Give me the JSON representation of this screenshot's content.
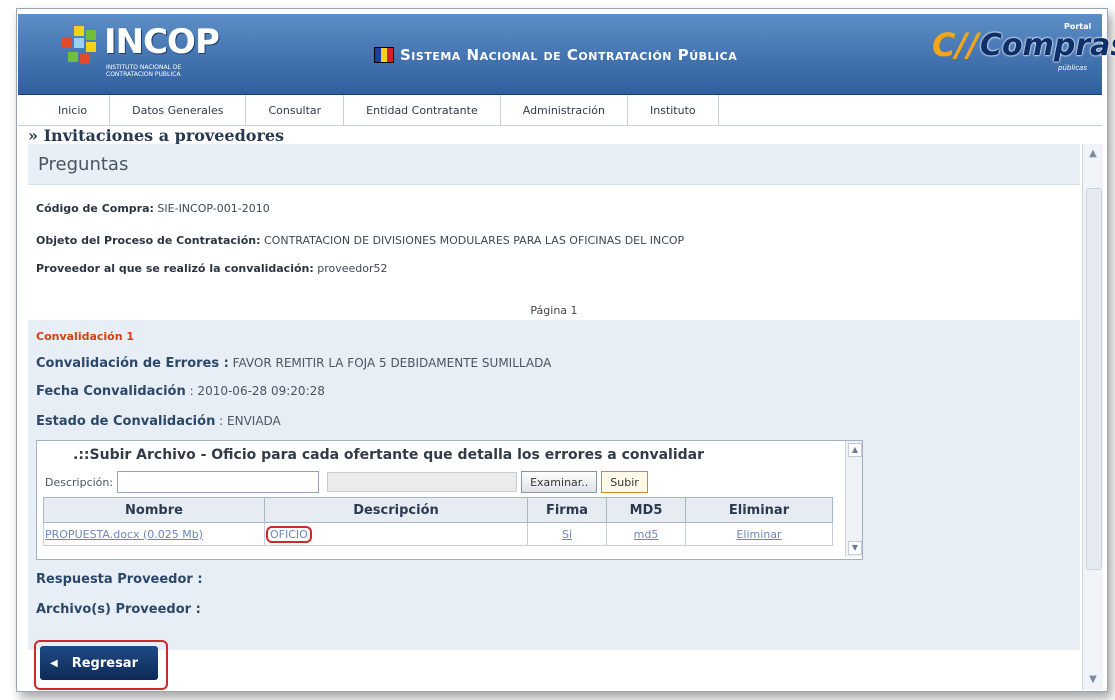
{
  "header": {
    "incop_logo": "INCOP",
    "incop_sub": "INSTITUTO NACIONAL DE CONTRATACION PUBLICA",
    "system_title": "Sistema Nacional de Contratación Pública",
    "compras_logo": "Compras",
    "compras_cc": "C//",
    "compras_top": "Portal",
    "compras_bottom": "públicas",
    "flag_colors": [
      "#1b3fa0",
      "#f4d21b",
      "#d4202a"
    ]
  },
  "nav": {
    "items": [
      "Inicio",
      "Datos Generales",
      "Consultar",
      "Entidad Contratante",
      "Administración",
      "Instituto"
    ]
  },
  "page": {
    "section": "» Invitaciones a proveedores",
    "subtitle": "Preguntas",
    "codigo_label": "Código de Compra:",
    "codigo_value": "SIE-INCOP-001-2010",
    "objeto_label": "Objeto del Proceso de Contratación:",
    "objeto_value": "CONTRATACION DE DIVISIONES MODULARES PARA LAS OFICINAS DEL INCOP",
    "proveedor_label": "Proveedor al que se realizó la convalidación:",
    "proveedor_value": "proveedor52",
    "pagina": "Página 1"
  },
  "convalidacion": {
    "title": "Convalidación 1",
    "errores_label": "Convalidación de Errores :",
    "errores_value": "FAVOR REMITIR LA FOJA 5 DEBIDAMENTE SUMILLADA",
    "fecha_label": "Fecha Convalidación",
    "fecha_value": ": 2010-06-28 09:20:28",
    "estado_label": "Estado de Convalidación",
    "estado_value": ": ENVIADA"
  },
  "upload": {
    "title": ".::Subir Archivo - Oficio para cada ofertante que detalla los errores a convalidar",
    "descripcion_label": "Descripción:",
    "descripcion_value": "",
    "examinar_label": "Examinar..",
    "subir_label": "Subir",
    "columns": [
      "Nombre",
      "Descripción",
      "Firma",
      "MD5",
      "Eliminar"
    ],
    "rows": [
      {
        "nombre": "PROPUESTA.docx (0.025 Mb)",
        "descripcion": "OFICIO",
        "firma": "Si",
        "md5": "md5",
        "eliminar": "Eliminar"
      }
    ]
  },
  "respuesta": {
    "respuesta_label": "Respuesta Proveedor :",
    "archivos_label": "Archivo(s) Proveedor :"
  },
  "back_button": "Regresar"
}
